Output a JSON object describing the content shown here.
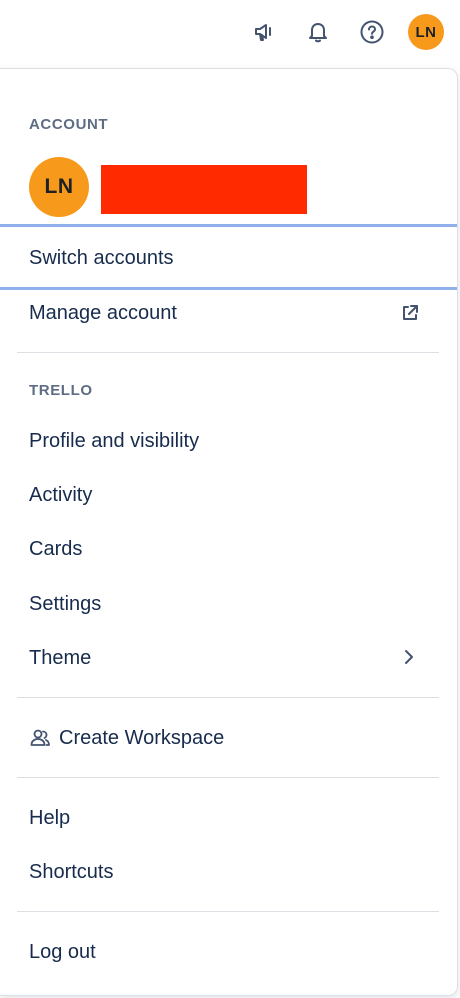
{
  "header": {
    "announcements_icon": "megaphone-icon",
    "notifications_icon": "bell-icon",
    "help_icon": "help-circle-icon",
    "avatar_initials": "LN",
    "avatar_color": "#f79a1b"
  },
  "menu": {
    "account_section": {
      "title": "ACCOUNT",
      "avatar_initials": "LN",
      "redaction_color": "#ff2a00"
    },
    "switch_accounts": "Switch accounts",
    "manage_account": "Manage account",
    "manage_account_icon": "external-link-icon",
    "trello_section": {
      "title": "TRELLO",
      "items": [
        {
          "label": "Profile and visibility"
        },
        {
          "label": "Activity"
        },
        {
          "label": "Cards"
        },
        {
          "label": "Settings"
        },
        {
          "label": "Theme",
          "icon": "chevron-right-icon"
        }
      ]
    },
    "create_workspace": {
      "label": "Create Workspace",
      "icon": "people-icon"
    },
    "help": "Help",
    "shortcuts": "Shortcuts",
    "log_out": "Log out",
    "focus_color": "#8fb0ec"
  }
}
